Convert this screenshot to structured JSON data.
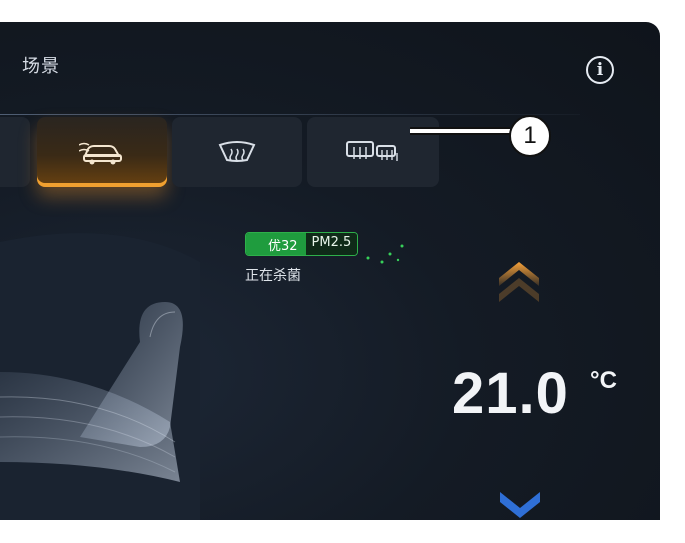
{
  "header": {
    "title": "场景",
    "info_icon": "i"
  },
  "modes": [
    {
      "name": "partial-mode",
      "icon": "mode-icon"
    },
    {
      "name": "car-ventilation",
      "icon": "car-ventilation-icon",
      "active": true
    },
    {
      "name": "front-defrost",
      "icon": "front-defrost-icon"
    },
    {
      "name": "rear-defrost",
      "icon": "rear-defrost-icon"
    }
  ],
  "callout": {
    "number": "1"
  },
  "air_quality": {
    "grade": "优32",
    "label": "PM2.5",
    "color": "#1f9c3e"
  },
  "status_text": "正在杀菌",
  "temperature": {
    "value": "21.0",
    "unit": "°C"
  },
  "colors": {
    "accent": "#f0a030",
    "down_arrow": "#2f6fd6",
    "background": "#141b25"
  }
}
